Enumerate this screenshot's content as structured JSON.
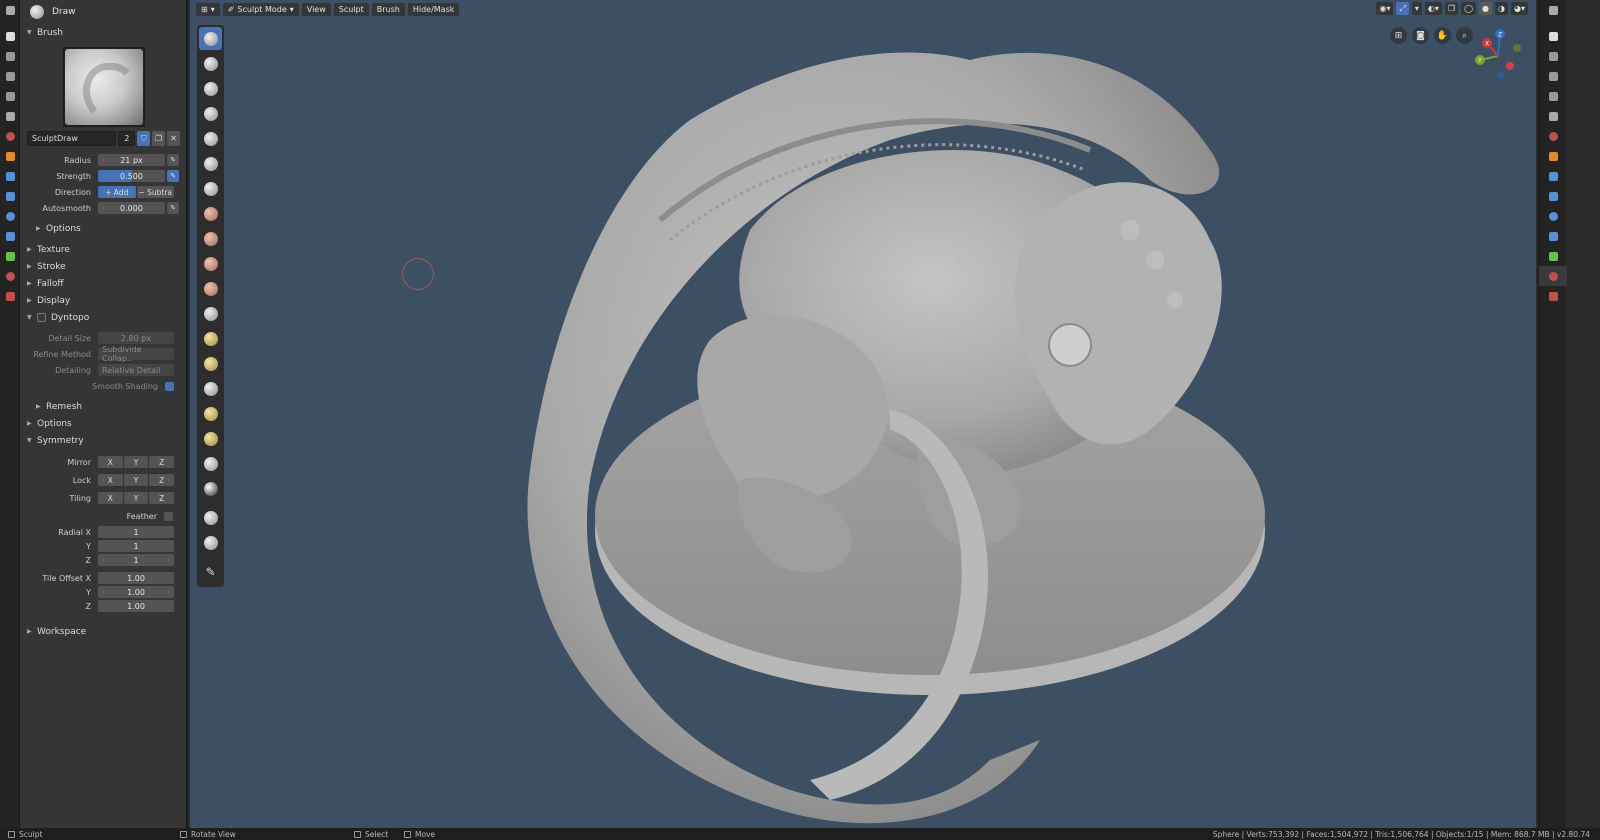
{
  "header": {
    "mode": "Sculpt Mode",
    "menus": [
      "View",
      "Sculpt",
      "Brush",
      "Hide/Mask"
    ]
  },
  "tool_header": {
    "title": "Draw"
  },
  "brush_panel": {
    "section": "Brush",
    "name": "SculptDraw",
    "users": "2",
    "radius_label": "Radius",
    "radius": "21 px",
    "strength_label": "Strength",
    "strength": "0.500",
    "strength_fraction": 0.5,
    "direction_label": "Direction",
    "direction_add": "+ Add",
    "direction_subtract": "− Subtra",
    "autosmooth_label": "Autosmooth",
    "autosmooth": "0.000",
    "options": "Options"
  },
  "sections": {
    "texture": "Texture",
    "stroke": "Stroke",
    "falloff": "Falloff",
    "display": "Display",
    "dyntopo": "Dyntopo",
    "remesh": "Remesh",
    "options": "Options",
    "symmetry": "Symmetry",
    "workspace": "Workspace"
  },
  "dyntopo": {
    "detail_size_label": "Detail Size",
    "detail_size": "2.80 px",
    "refine_method_label": "Refine Method",
    "refine_method": "Subdivide Collap..",
    "detailing_label": "Detailing",
    "detailing": "Relative Detail",
    "smooth_shading_label": "Smooth Shading"
  },
  "symmetry": {
    "mirror_label": "Mirror",
    "lock_label": "Lock",
    "tiling_label": "Tiling",
    "axes": [
      "X",
      "Y",
      "Z"
    ],
    "feather_label": "Feather",
    "radial_x_label": "Radial X",
    "radial_x": "1",
    "y_label": "Y",
    "radial_y": "1",
    "z_label": "Z",
    "radial_z": "1",
    "tile_offset_x_label": "Tile Offset X",
    "tile_offset_x": "1.00",
    "tile_offset_y": "1.00",
    "tile_offset_z": "1.00"
  },
  "status_bar": {
    "mode": "Sculpt",
    "rotate": "Rotate View",
    "select": "Select",
    "move": "Move",
    "stats": "Sphere | Verts:753,392 | Faces:1,504,972 | Tris:1,506,764 | Objects:1/15 | Mem: 868.7 MB | v2.80.74"
  },
  "gizmo": {
    "x": "X",
    "y": "Y",
    "z": "Z"
  },
  "colors": {
    "accent": "#4772b3",
    "viewport_bg": "#3d4f62",
    "panel_bg": "#353535"
  }
}
